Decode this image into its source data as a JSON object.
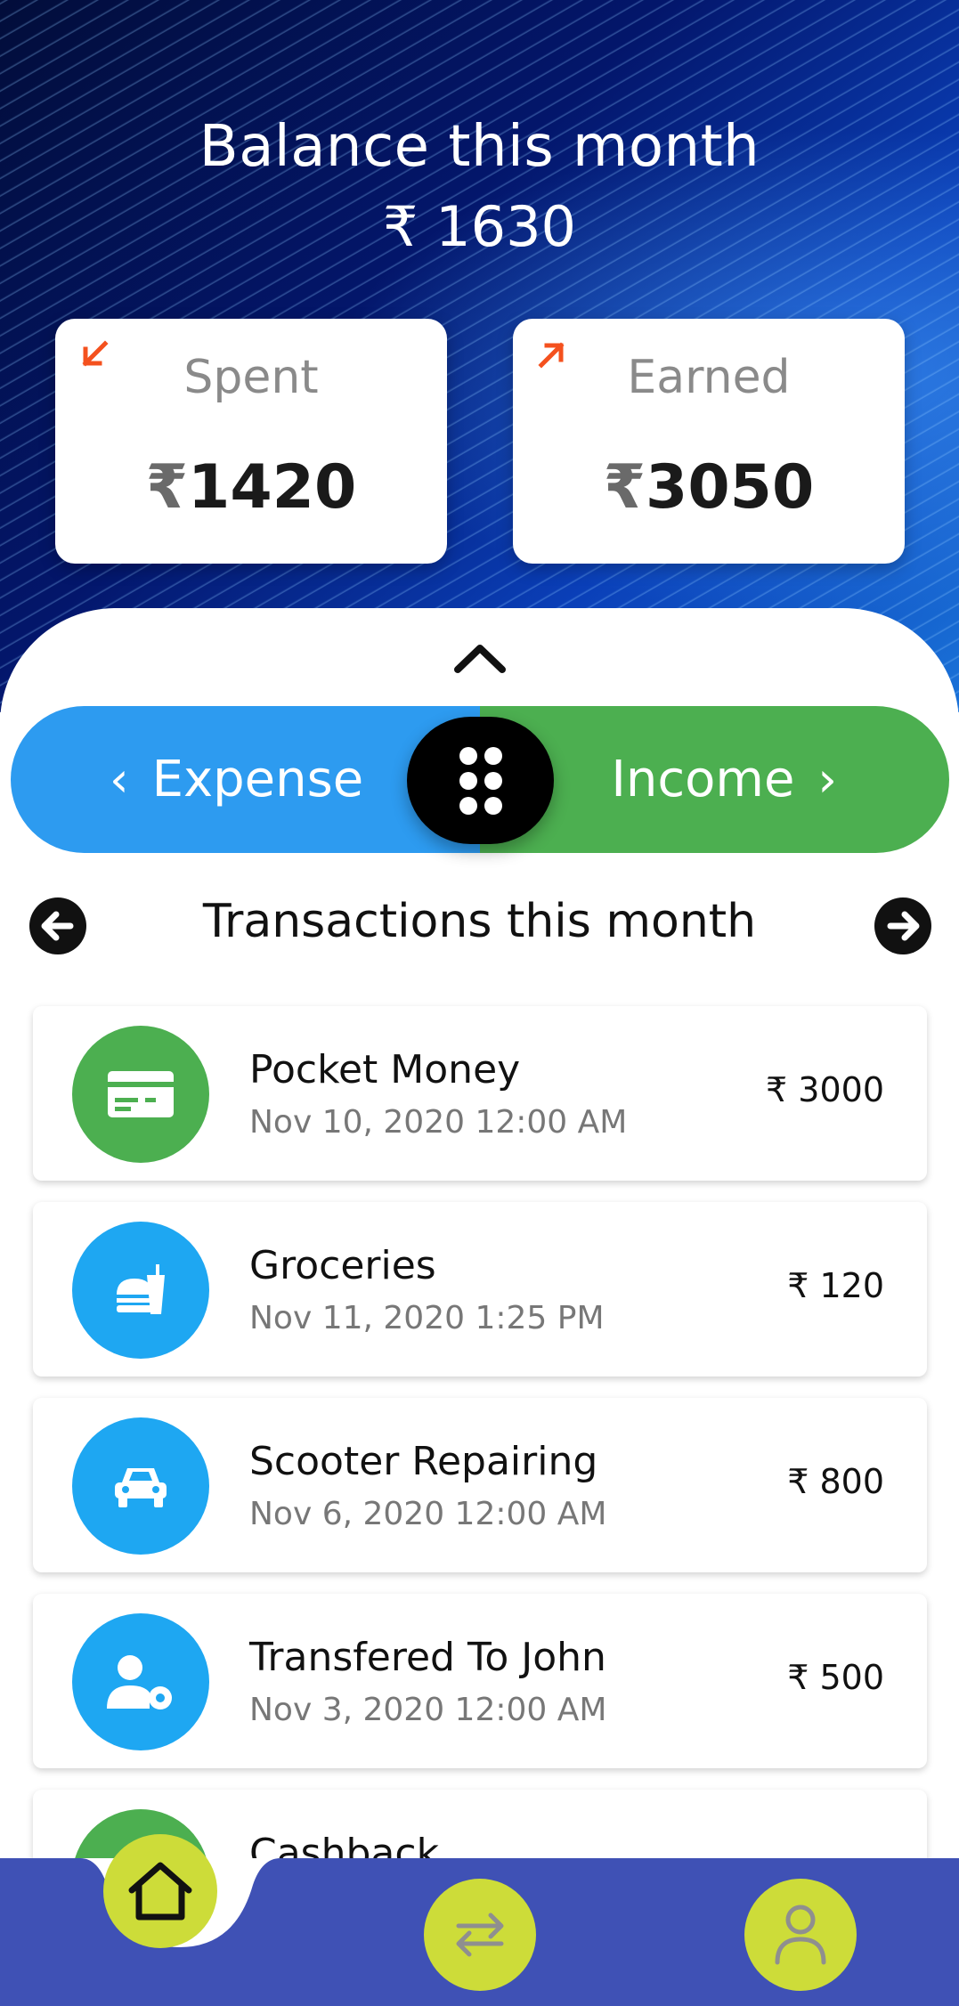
{
  "header": {
    "title": "Balance this month",
    "balance": "₹ 1630"
  },
  "stats": {
    "spent": {
      "label": "Spent",
      "currency": "₹",
      "amount": "1420",
      "arrow_color": "#f4511e"
    },
    "earned": {
      "label": "Earned",
      "currency": "₹",
      "amount": "3050",
      "arrow_color": "#f4511e"
    }
  },
  "toggle": {
    "expense_label": "Expense",
    "income_label": "Income",
    "expense_color": "#2d9bf0",
    "income_color": "#4caf50"
  },
  "transactions": {
    "title": "Transactions this month",
    "items": [
      {
        "name": "Pocket Money",
        "date": "Nov 10, 2020 12:00 AM",
        "amount": "₹ 3000",
        "icon": "money-card-icon",
        "color": "#4caf50"
      },
      {
        "name": "Groceries",
        "date": "Nov 11, 2020 1:25 PM",
        "amount": "₹ 120",
        "icon": "food-icon",
        "color": "#1ea7f2"
      },
      {
        "name": "Scooter Repairing",
        "date": "Nov 6, 2020 12:00 AM",
        "amount": "₹ 800",
        "icon": "car-icon",
        "color": "#1ea7f2"
      },
      {
        "name": "Transfered To John",
        "date": "Nov 3, 2020 12:00 AM",
        "amount": "₹ 500",
        "icon": "user-settings-icon",
        "color": "#1ea7f2"
      },
      {
        "name": "Cashback",
        "date": "",
        "amount": "",
        "icon": "money-card-icon",
        "color": "#4caf50"
      }
    ]
  },
  "bottom_nav": {
    "color": "#3f51b5",
    "button_color": "#cddc39",
    "items": [
      "home-icon",
      "transfer-icon",
      "profile-icon"
    ]
  }
}
